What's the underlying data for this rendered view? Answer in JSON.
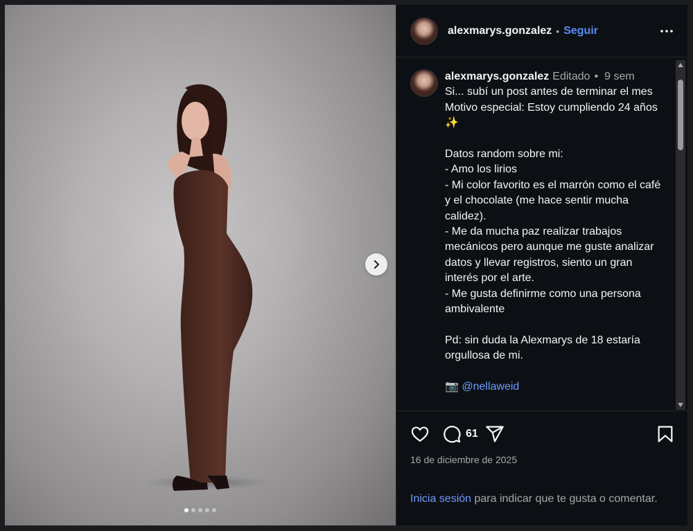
{
  "post": {
    "username": "alexmarys.gonzalez",
    "follow_label": "Seguir",
    "separator": "•",
    "more_icon": "more-horizontal-icon"
  },
  "caption": {
    "username": "alexmarys.gonzalez",
    "edited_label": "Editado",
    "separator": "•",
    "time": "9 sem",
    "text": "Si... subí un post antes de terminar el mes\nMotivo especial: Estoy cumpliendo 24 años ✨\n\nDatos random sobre mi:\n- Amo los lirios\n- Mi color favorito es el marrón como el café y el chocolate (me hace sentir mucha calidez).\n- Me da mucha paz realizar trabajos mecánicos pero aunque me guste analizar datos y llevar registros, siento un gran interés por el arte.\n- Me gusta definirme como una persona ambivalente\n\nPd: sin duda la Alexmarys de 18 estaría orgullosa de mi.\n\n",
    "camera_emoji": "📷",
    "mention": "@nellaweid"
  },
  "actions": {
    "like_icon": "heart-icon",
    "comment_icon": "comment-icon",
    "comment_count": "61",
    "share_icon": "send-icon",
    "save_icon": "bookmark-icon"
  },
  "date": "16 de diciembre de 2025",
  "login_prompt": {
    "link": "Inicia sesión",
    "text": " para indicar que te gusta o comentar."
  },
  "carousel": {
    "total_slides": 5,
    "active_slide": 1
  },
  "colors": {
    "accent": "#5b8cf7",
    "background": "#0c0f14",
    "dress": "#4a2a22"
  }
}
